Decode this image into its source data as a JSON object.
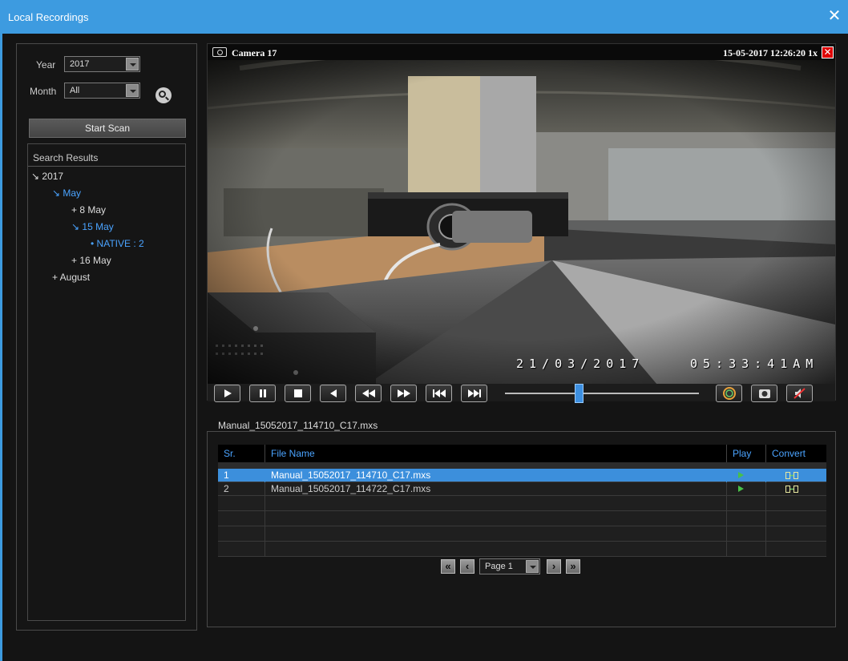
{
  "window": {
    "title": "Local Recordings",
    "close_glyph": "✕"
  },
  "filters": {
    "year_label": "Year",
    "year_value": "2017",
    "month_label": "Month",
    "month_value": "All",
    "start_scan_label": "Start Scan"
  },
  "results": {
    "header": "Search Results",
    "tree": [
      {
        "label": "↘ 2017",
        "level": 0,
        "color": "white"
      },
      {
        "label": "↘ May",
        "level": 1,
        "color": "blue"
      },
      {
        "label": "+ 8 May",
        "level": 2,
        "color": "white"
      },
      {
        "label": "↘ 15 May",
        "level": 2,
        "color": "blue"
      },
      {
        "label": "• NATIVE : 2",
        "level": 3,
        "color": "blue"
      },
      {
        "label": "+ 16 May",
        "level": 2,
        "color": "white"
      },
      {
        "label": "+ August",
        "level": 1,
        "color": "white"
      }
    ]
  },
  "video": {
    "camera_title": "Camera 17",
    "header_time": "15-05-2017  12:26:20 1x",
    "osd_date": "21/03/2017",
    "osd_time": "05:33:41AM",
    "playback_progress": 0.38
  },
  "current_file": "Manual_15052017_114710_C17.mxs",
  "files": {
    "columns": [
      "Sr.",
      "File Name",
      "Play",
      "Convert"
    ],
    "rows": [
      {
        "sr": "1",
        "name": "Manual_15052017_114710_C17.mxs",
        "selected": true
      },
      {
        "sr": "2",
        "name": "Manual_15052017_114722_C17.mxs",
        "selected": false
      }
    ],
    "empty_rows": 4
  },
  "pager": {
    "page_value": "Page 1",
    "first": "«",
    "prev": "‹",
    "next": "›",
    "last": "»"
  },
  "colors": {
    "accent": "#3d9be0",
    "link": "#4aa3ff",
    "selected_row": "#3c8fdc",
    "play": "#48c048"
  }
}
